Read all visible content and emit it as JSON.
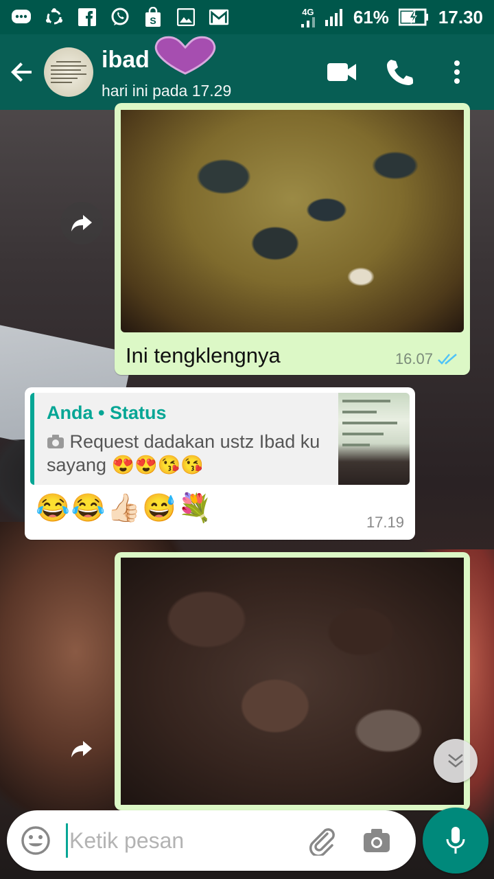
{
  "status_bar": {
    "network": "4G",
    "battery": "61%",
    "time": "17.30",
    "notification_icons": [
      "chat-icon",
      "sync-icon",
      "facebook-icon",
      "whatsapp-icon",
      "shopping-icon",
      "gallery-icon",
      "email-icon"
    ]
  },
  "header": {
    "contact_name": "ibad",
    "last_seen": "hari ini pada 17.29",
    "actions": [
      "video-call-icon",
      "phone-call-icon",
      "more-options-icon"
    ]
  },
  "messages": [
    {
      "type": "outgoing-image",
      "caption": "Ini tengklengnya",
      "time": "16.07",
      "status": "read"
    },
    {
      "type": "incoming-reply",
      "quote_title": "Anda • Status",
      "quote_text": "Request dadakan ustz Ibad ku sayang 😍😍😘😘",
      "text": "😂😂👍🏻😅💐",
      "time": "17.19"
    },
    {
      "type": "outgoing-image"
    }
  ],
  "composer": {
    "placeholder": "Ketik pesan"
  },
  "colors": {
    "primary": "#075e54",
    "status_bar": "#00574b",
    "outgoing_bubble": "#dcf8c6",
    "accent": "#06a695",
    "mic": "#00897b"
  }
}
